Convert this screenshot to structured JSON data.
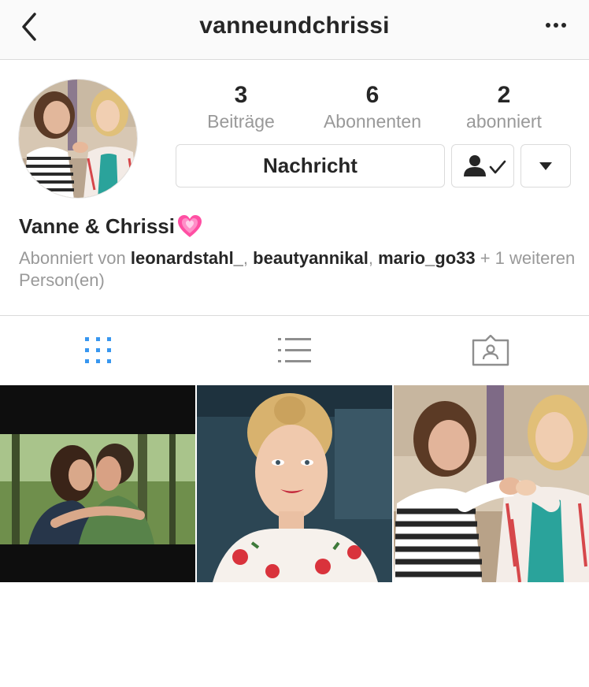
{
  "header": {
    "title": "vanneundchrissi",
    "back_icon": "chevron-left-icon",
    "more_icon": "more-dots-icon"
  },
  "stats": [
    {
      "value": "3",
      "label": "Beiträge"
    },
    {
      "value": "6",
      "label": "Abonnenten"
    },
    {
      "value": "2",
      "label": "abonniert"
    }
  ],
  "actions": {
    "message_label": "Nachricht",
    "following_icon": "person-check-icon",
    "dropdown_icon": "caret-down-icon"
  },
  "profile": {
    "name": "Vanne & Chrissi",
    "name_emoji": "sparkling-heart-icon",
    "followed_prefix": "Abonniert von ",
    "followers": [
      "leonardstahl_",
      "beautyannikal",
      "mario_go33"
    ],
    "separator": ", ",
    "followed_suffix": " + 1 weiteren Person(en)"
  },
  "tabs": [
    {
      "icon": "grid-icon",
      "active": true
    },
    {
      "icon": "list-icon",
      "active": false
    },
    {
      "icon": "tagged-icon",
      "active": false
    }
  ],
  "colors": {
    "accent": "#3897f0",
    "text": "#262626",
    "muted": "#999999",
    "border": "#dbdbdb",
    "heart": "#ff4fa3"
  }
}
